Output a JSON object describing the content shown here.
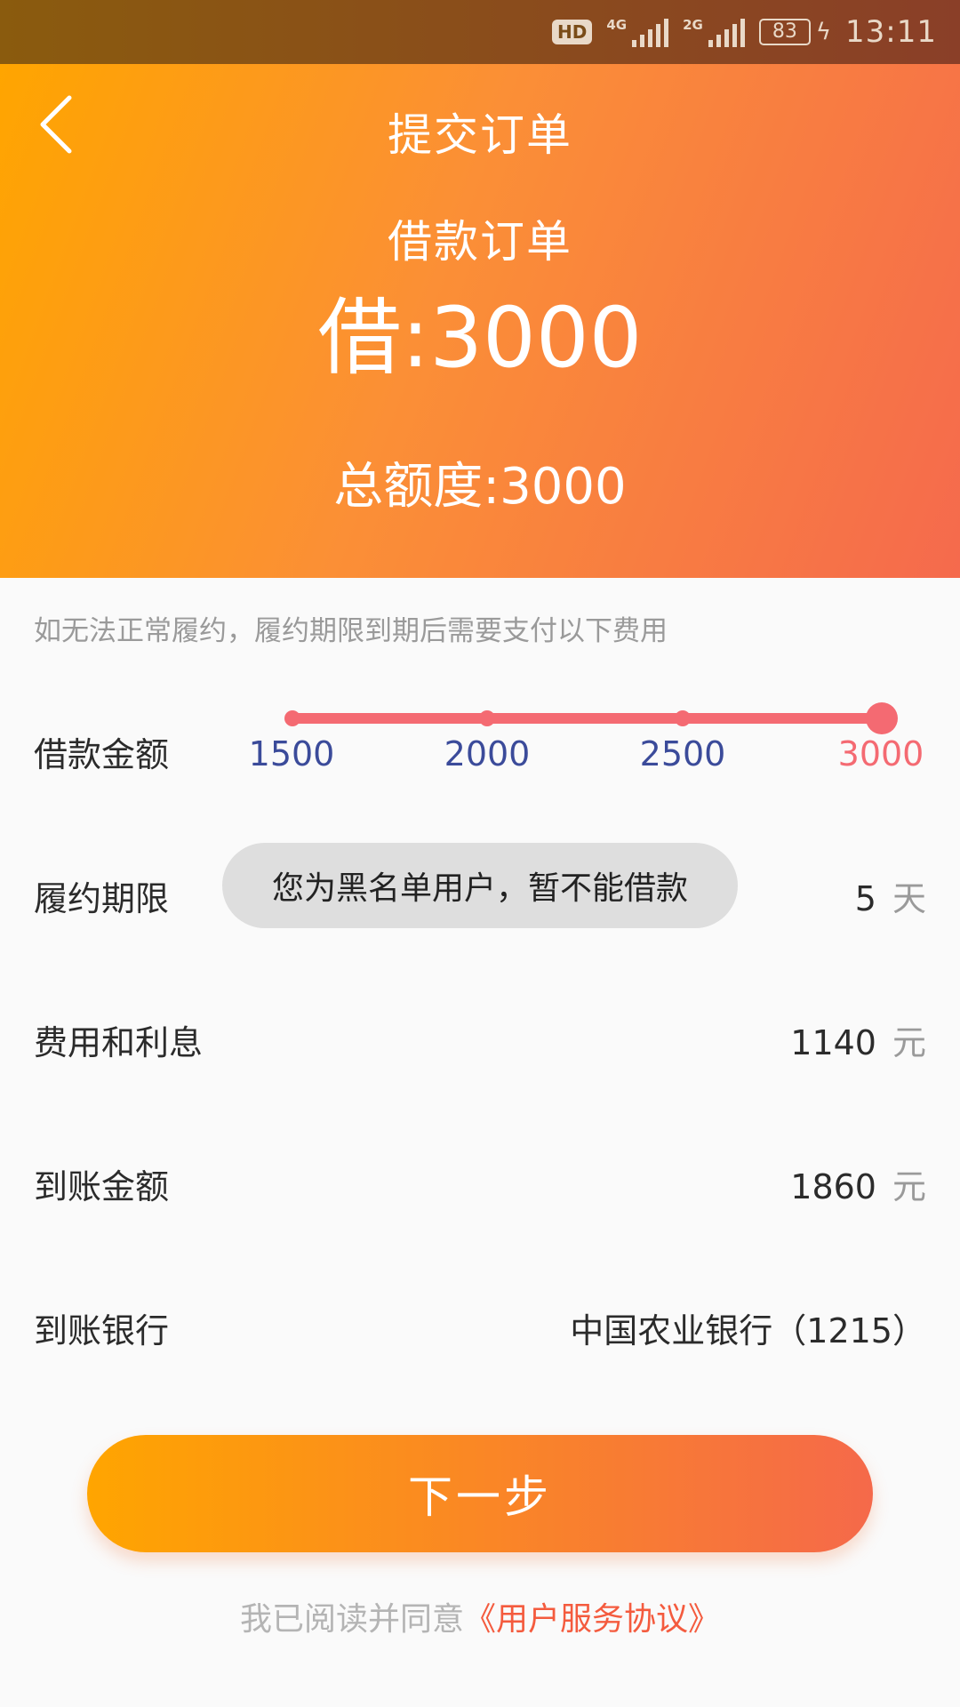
{
  "status_bar": {
    "hd": "HD",
    "net1": "4G",
    "net2": "2G",
    "battery": "83",
    "time": "13:11"
  },
  "header": {
    "title": "提交订单",
    "order_label": "借款订单",
    "borrow_amount": "借:3000",
    "total_limit": "总额度:3000"
  },
  "notice": "如无法正常履约，履约期限到期后需要支付以下费用",
  "loan_amount": {
    "label": "借款金额",
    "options": [
      "1500",
      "2000",
      "2500",
      "3000"
    ],
    "selected": "3000",
    "selected_fraction": 1.0
  },
  "term": {
    "label": "履约期限",
    "value": "5",
    "unit": "天"
  },
  "toast": "您为黑名单用户，暂不能借款",
  "fees": {
    "label": "费用和利息",
    "value": "1140",
    "unit": "元"
  },
  "received": {
    "label": "到账金额",
    "value": "1860",
    "unit": "元"
  },
  "bank": {
    "label": "到账银行",
    "value": "中国农业银行（1215）"
  },
  "next_button": "下一步",
  "agreement": {
    "prefix": "我已阅读并同意",
    "link": "《用户服务协议》"
  },
  "colors": {
    "accent_start": "#ffa500",
    "accent_end": "#f5694a",
    "slider": "#f46a72",
    "tick_text": "#3b4b9a"
  },
  "icons": {
    "back": "chevron-left-icon",
    "signal": "signal-icon",
    "battery": "battery-icon"
  }
}
